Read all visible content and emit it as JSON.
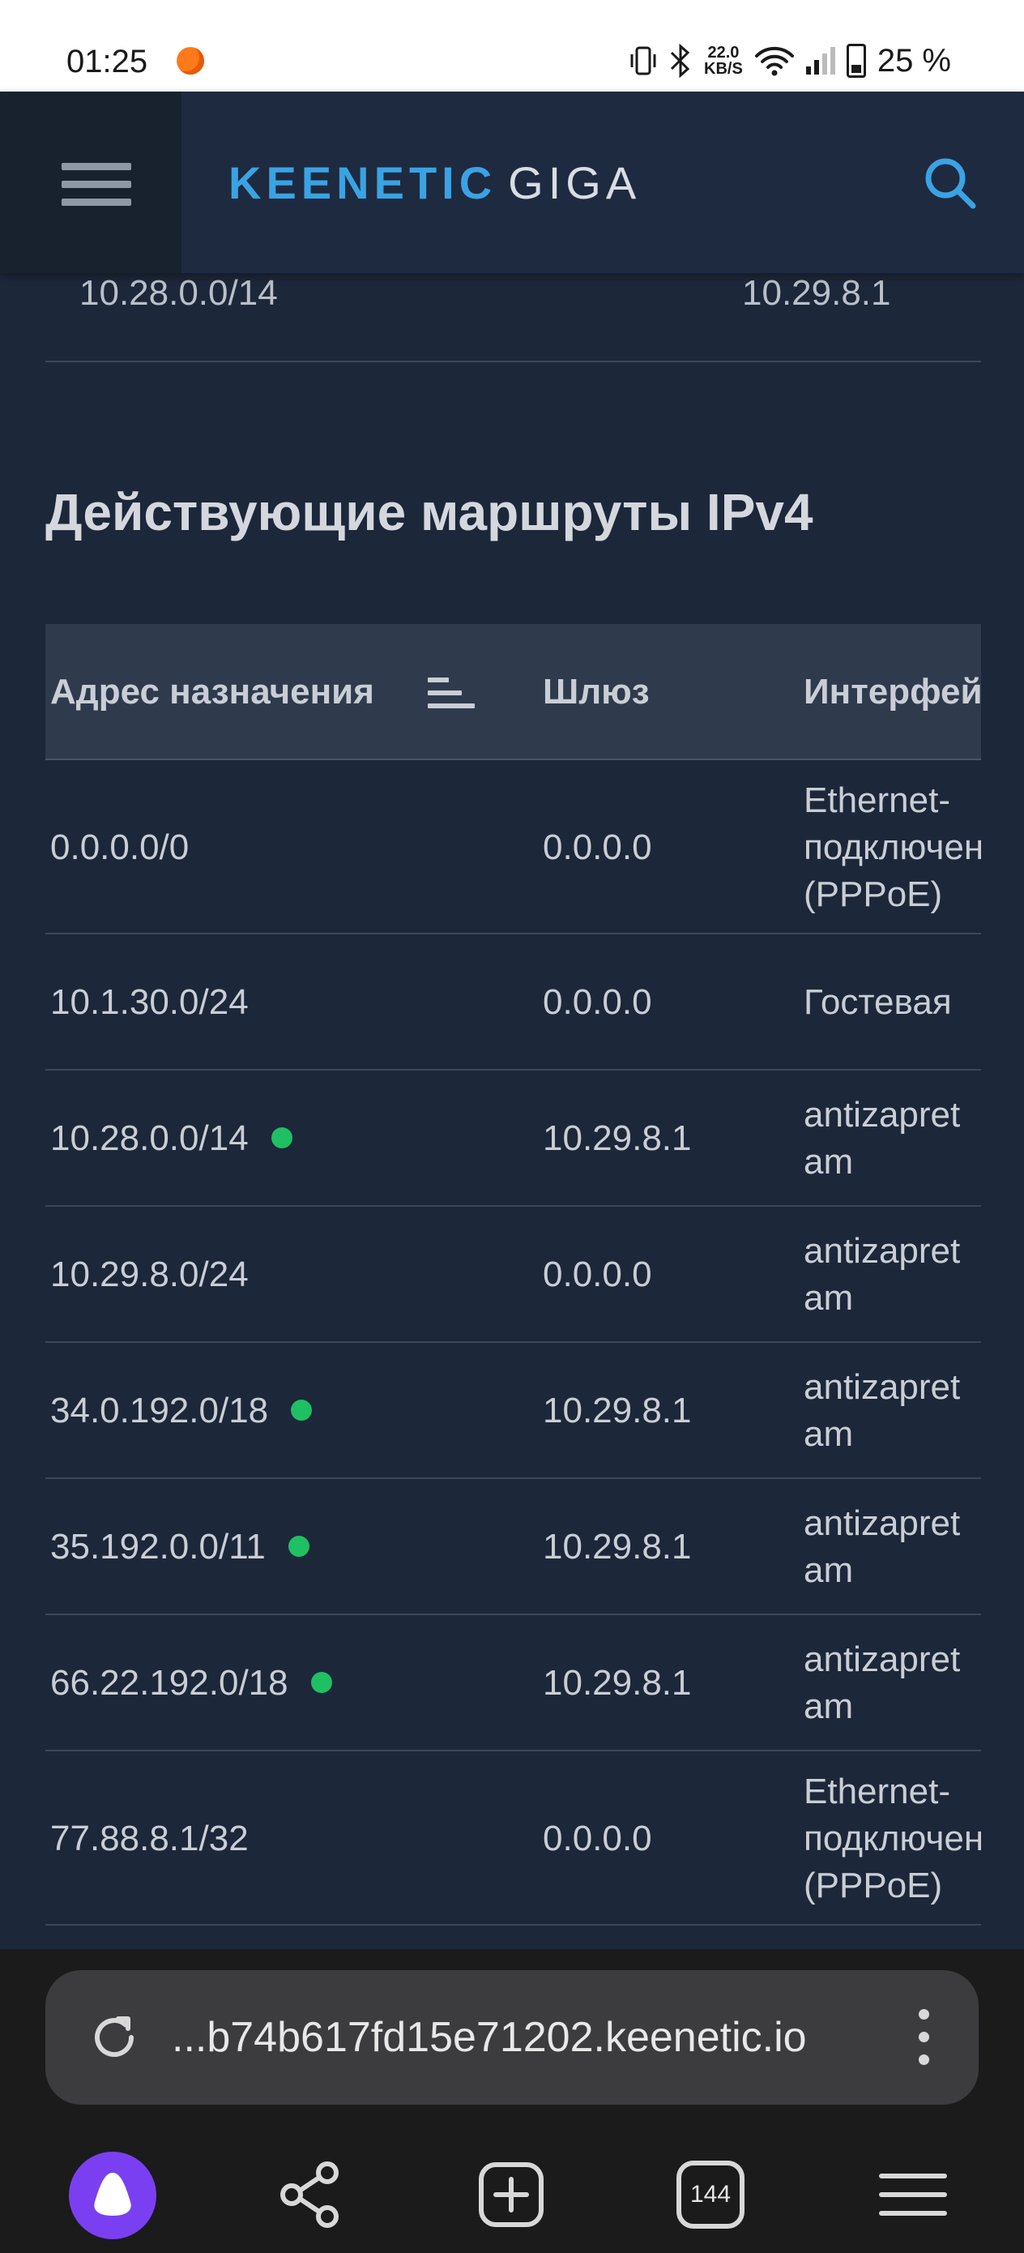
{
  "status_bar": {
    "time": "01:25",
    "net_speed_value": "22.0",
    "net_speed_unit": "KB/S",
    "battery": "25 %"
  },
  "header": {
    "brand_primary": "KEENETIC",
    "brand_secondary": "GIGA"
  },
  "previous_table_row": {
    "destination": "10.28.0.0/14",
    "gateway": "10.29.8.1"
  },
  "routes_section": {
    "title": "Действующие маршруты IPv4",
    "columns": [
      "Адрес назначения",
      "Шлюз",
      "Интерфейс"
    ],
    "rows": [
      {
        "destination": "0.0.0.0/0",
        "gateway": "0.0.0.0",
        "interface": [
          "Ethernet-",
          "подключение",
          "(PPPoE)"
        ],
        "active": false
      },
      {
        "destination": "10.1.30.0/24",
        "gateway": "0.0.0.0",
        "interface": [
          "Гостевая"
        ],
        "active": false
      },
      {
        "destination": "10.28.0.0/14",
        "gateway": "10.29.8.1",
        "interface": [
          "antizapret",
          "am"
        ],
        "active": true
      },
      {
        "destination": "10.29.8.0/24",
        "gateway": "0.0.0.0",
        "interface": [
          "antizapret",
          "am"
        ],
        "active": false
      },
      {
        "destination": "34.0.192.0/18",
        "gateway": "10.29.8.1",
        "interface": [
          "antizapret",
          "am"
        ],
        "active": true
      },
      {
        "destination": "35.192.0.0/11",
        "gateway": "10.29.8.1",
        "interface": [
          "antizapret",
          "am"
        ],
        "active": true
      },
      {
        "destination": "66.22.192.0/18",
        "gateway": "10.29.8.1",
        "interface": [
          "antizapret",
          "am"
        ],
        "active": true
      },
      {
        "destination": "77.88.8.1/32",
        "gateway": "0.0.0.0",
        "interface": [
          "Ethernet-",
          "подключение",
          "(PPPoE)"
        ],
        "active": false
      }
    ]
  },
  "browser": {
    "url": "...b74b617fd15e71202.keenetic.io",
    "tabs_count": "144"
  },
  "colors": {
    "accent": "#3aa3e3",
    "active_route": "#1fbf63",
    "background": "#1d273a"
  }
}
